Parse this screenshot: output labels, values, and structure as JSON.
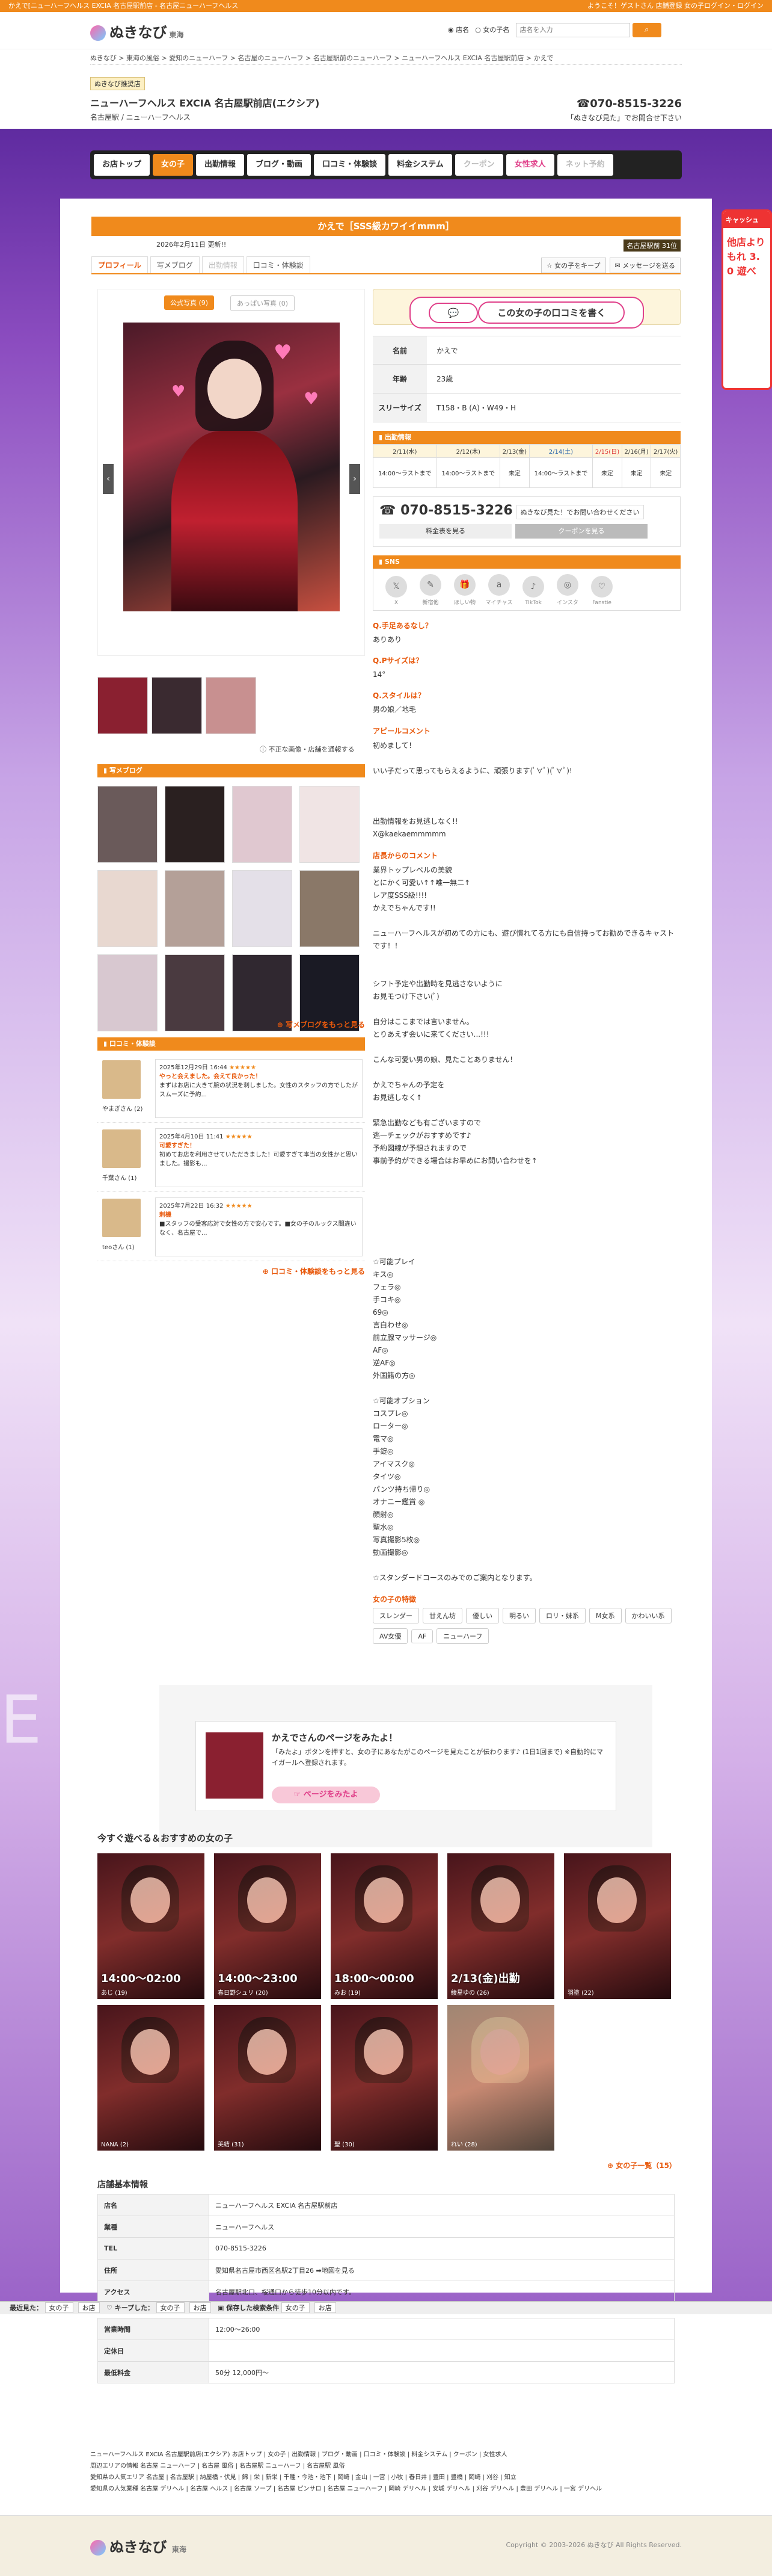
{
  "top_strip": {
    "left": "かえで[ニューハーフヘルス EXCIA 名古屋駅前店 - 名古屋ニューハーフヘルス",
    "right": "ようこそ！ゲストさん  店舗登録  女の子ログイン・ログイン"
  },
  "header": {
    "logo": "ぬきなび",
    "region": "東海",
    "search_radio1": "店名",
    "search_radio2": "女の子名",
    "search_placeholder": "店名を入力",
    "search_button": "検索"
  },
  "breadcrumb": "ぬきなび > 東海の風俗 > 愛知のニューハーフ > 名古屋のニューハーフ > 名古屋駅前のニューハーフ > ニューハーフヘルス EXCIA 名古屋駅前店 > かえで",
  "shop": {
    "badge": "ぬきなび推奨店",
    "name": "ニューハーフヘルス EXCIA 名古屋駅前店(エクシア)",
    "sub": "名古屋駅 / ニューハーフヘルス",
    "tel": "070-8515-3226",
    "tel_note": "「ぬきなび見た」でお問合せ下さい"
  },
  "nav": {
    "items": [
      "お店トップ",
      "女の子",
      "出勤情報",
      "ブログ・動画",
      "口コミ・体験談",
      "料金システム",
      "クーポン",
      "女性求人",
      "ネット予約"
    ]
  },
  "side_ad": {
    "title": "キャッシュ",
    "body": "他店より もれ 3. 0 遊べ"
  },
  "girl": {
    "title": "かえで［SSS級カワイイmmm］",
    "updated": "2026年2月11日 更新!!",
    "area": "名古屋駅前 31位",
    "tabs": [
      "プロフィール",
      "写メブログ",
      "出勤情報",
      "口コミ・体験談"
    ],
    "tab_right": [
      "☆ 女の子をキープ",
      "✉ メッセージを送る"
    ],
    "gallery_tabs": [
      "公式写真 (9)",
      "あっぱい写真 (0)"
    ],
    "gallery_note": "不正な画像・店舗を通報する"
  },
  "profile": {
    "kuchi_btn": "この女の子の口コミを書く",
    "rows": [
      {
        "k": "名前",
        "v": "かえで"
      },
      {
        "k": "年齢",
        "v": "23歳"
      },
      {
        "k": "スリーサイズ",
        "v": "T158・B (A)・W49・H"
      }
    ]
  },
  "schedule": {
    "title": "出勤情報",
    "days": [
      "2/11(水)",
      "2/12(木)",
      "2/13(金)",
      "2/14(土)",
      "2/15(日)",
      "2/16(月)",
      "2/17(火)"
    ],
    "times": [
      "14:00～ラストまで",
      "14:00～ラストまで",
      "未定",
      "14:00～ラストまで",
      "未定",
      "未定",
      "未定"
    ]
  },
  "tel_box": {
    "num": "070-8515-3226",
    "msg": "ぬきなび見た！でお問い合わせください",
    "b1": "料金表を見る",
    "b2": "クーポンを見る"
  },
  "sns": {
    "title": "SNS",
    "items": [
      "X",
      "新宿他",
      "ほしい物",
      "マイチャス",
      "TikTok",
      "インスタ",
      "Fanstie"
    ]
  },
  "qa": [
    {
      "q": "Q.手足あるなし？",
      "a": "ありあり"
    },
    {
      "q": "Q.Pサイズは？",
      "a": "14°"
    },
    {
      "q": "Q.スタイルは？",
      "a": "男の娘／地毛"
    }
  ],
  "appeal": {
    "title": "アピールコメント",
    "text": "初めまして！\n\nいい子だって思ってもらえるように、頑張ります(ﾟ∀ﾟ)(ﾟ∀ﾟ)!\n\n\n\n出勤情報をお見逃しなく!!\nX@kaekaemmmmm"
  },
  "shop_comment": {
    "title": "店長からのコメント",
    "text": "業界トップレベルの美貌\nとにかく可愛い↑↑唯一無二↑\nレア度SSS級!!!!\nかえでちゃんです!!\n\nニューハーフヘルスが初めての方にも、遊び慣れてる方にも自信持ってお勧めできるキャストです！！\n\n\nシフト予定や出勤時を見逃さないように\nお見モつけ下さい(ﾟ)\n\n自分はここまでは言いません。\nとりあえず会いに来てください...!!!\n\nこんな可愛い男の娘、見たことありません！\n\nかえでちゃんの予定を\nお見逃しなく↑\n\n緊急出勤なども有ございますので\n逃一チェックがおすすめです♪\n予約図線が予想されますので\n事前予約ができる場合はお早めにお問い合わせを↑\n\n\n\n\n\n\n\n☆可能プレイ\nキス◎\nフェラ◎\n手コキ◎\n69◎\n言白わせ◎\n前立腺マッサージ◎\nAF◎\n逆AF◎\n外国籍の方◎\n\n☆可能オプション\nコスプレ◎\nローター◎\n電マ◎\n手錠◎\nアイマスク◎\nタイツ◎\nパンツ持ち帰り◎\nオナニー鑑賞 ◎\n顔射◎\n聖水◎\n写真撮影5枚◎\n動画撮影◎\n\n☆スタンダードコースのみでのご案内となります。"
  },
  "features": {
    "title": "女の子の特徴",
    "tags": [
      "スレンダー",
      "甘えん坊",
      "優しい",
      "明るい",
      "ロリ・妹系",
      "M女系",
      "かわいい系",
      "AV女優",
      "AF",
      "ニューハーフ"
    ]
  },
  "blog": {
    "title": "写メブログ",
    "more": "写メブログをもっと見る"
  },
  "reviews": {
    "title": "口コミ・体験談",
    "more": "口コミ・体験談をもっと見る",
    "items": [
      {
        "name": "やまぎさん (2)",
        "date": "2025年12月29日 16:44",
        "stars": "★★★★★",
        "head": "やっと会えました。会えて良かった！",
        "body": "まずはお店に大きて腕の状況を刺しました。女性のスタッフの方でしたがスムーズに予約..."
      },
      {
        "name": "千葉さん (1)",
        "date": "2025年4月10日 11:41",
        "stars": "★★★★★",
        "head": "可愛すぎた！",
        "body": "初めてお店を利用させていただきました！可愛すぎて本当の女性かと思いました。撮影も..."
      },
      {
        "name": "teoさん (1)",
        "date": "2025年7月22日 16:32",
        "stars": "★★★★★",
        "head": "刺機",
        "body": "■スタッフの受客応対で女性の方で安心です。■女の子のルックス間違いなく、名古屋で..."
      }
    ]
  },
  "mitai": {
    "title": "かえでさんのページをみたよ！",
    "desc": "「みたよ」ボタンを押すと、女の子にあなたがこのページを見たことが伝わります♪ (1日1回まで) ※自動的にマイガールへ登録されます。",
    "btn": "ページをみたよ"
  },
  "recommend": {
    "title": "今すぐ遊べる＆おすすめの女の子",
    "more": "女の子一覧（15）",
    "cards": [
      {
        "time": "14:00～02:00",
        "name": "あじ (19)"
      },
      {
        "time": "14:00～23:00",
        "name": "春日野シュリ (20)"
      },
      {
        "time": "18:00～00:00",
        "name": "みお (19)"
      },
      {
        "time": "2/13(金)出勤",
        "name": "綾星ゆの (26)"
      },
      {
        "time": "",
        "name": "羽塗 (22)"
      },
      {
        "time": "",
        "name": "NANA (2)"
      },
      {
        "time": "",
        "name": "美結 (31)"
      },
      {
        "time": "",
        "name": "聖 (30)"
      },
      {
        "time": "",
        "name": "れい (28)"
      }
    ]
  },
  "shop_info": {
    "title": "店舗基本情報",
    "rows": [
      {
        "k": "店名",
        "v": "ニューハーフヘルス EXCIA 名古屋駅前店"
      },
      {
        "k": "業種",
        "v": "ニューハーフヘルス"
      },
      {
        "k": "TEL",
        "v": "070-8515-3226"
      },
      {
        "k": "住所",
        "v": "愛知県名古屋市西区名駅2丁目26 ➡地図を見る"
      },
      {
        "k": "アクセス",
        "v": "名古屋駅北口、桜通口から徒歩10分以内です。"
      }
    ],
    "rows2": [
      {
        "k": "営業時間",
        "v": "12:00～26:00"
      },
      {
        "k": "定休日",
        "v": ""
      },
      {
        "k": "最低料金",
        "v": "50分 12,000円～"
      }
    ]
  },
  "floatbar": {
    "label": "最近見た：",
    "items": [
      "女の子",
      "お店",
      "キープした：",
      "女の子",
      "お店",
      "保存した検索条件",
      "女の子",
      "お店"
    ]
  },
  "footer": {
    "l1": "ニューハーフヘルス EXCIA 名古屋駅前店(エクシア)  お店トップ | 女の子 | 出勤情報 | ブログ・動画 | 口コミ・体験談 | 料金システム | クーポン | 女性求人",
    "l2": "周辺エリアの情報  名古屋 ニューハーフ | 名古屋 風俗 | 名古屋駅 ニューハーフ | 名古屋駅 風俗",
    "l3": "愛知県の人気エリア  名古屋 | 名古屋駅 | 納屋橋・伏見 | 錦 | 栄 | 新栄 | 千種・今池・池下 | 岡崎 | 金山 | 一宮 | 小牧 | 春日井 | 豊田 | 豊橋 | 岡崎 | 刈谷 | 知立",
    "l4": "愛知県の人気業種  名古屋 デリヘル | 名古屋 ヘルス | 名古屋 ソープ | 名古屋 ピンサロ | 名古屋 ニューハーフ | 岡崎 デリヘル | 安城 デリヘル | 刈谷 デリヘル | 豊田 デリヘル | 一宮 デリヘル"
  },
  "bottom": {
    "logo": "ぬきなび",
    "region": "東海",
    "copy": "Copyright © 2003-2026 ぬきなび All Rights Reserved."
  }
}
